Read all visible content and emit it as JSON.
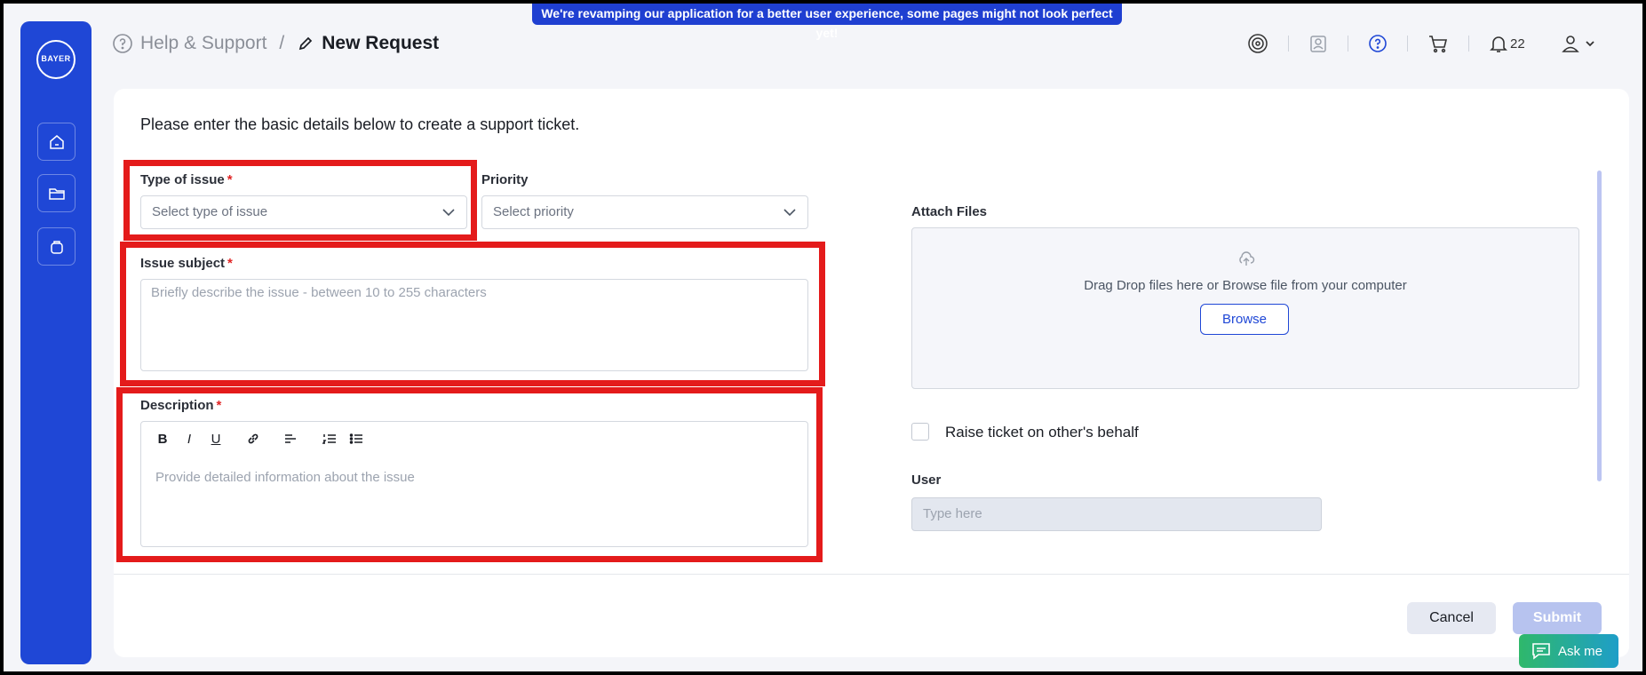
{
  "banner": {
    "text": "We're revamping our application for a better user experience, some pages might not look perfect yet!"
  },
  "sidebar": {
    "logo_text": "BAYER",
    "logo_vertical": "BAYER",
    "items": [
      {
        "icon": "home-icon"
      },
      {
        "icon": "folder-icon"
      },
      {
        "icon": "bag-icon"
      }
    ]
  },
  "breadcrumb": {
    "parent": "Help & Support",
    "separator": "/",
    "current": "New Request"
  },
  "header_icons": {
    "notification_count": "22"
  },
  "form": {
    "intro": "Please enter the basic details below to create a support ticket.",
    "type_of_issue": {
      "label": "Type of issue",
      "required_mark": "*",
      "placeholder": "Select type of issue"
    },
    "priority": {
      "label": "Priority",
      "placeholder": "Select priority"
    },
    "issue_subject": {
      "label": "Issue subject",
      "required_mark": "*",
      "placeholder": "Briefly describe the issue - between 10 to 255 characters"
    },
    "description": {
      "label": "Description",
      "required_mark": "*",
      "placeholder": "Provide detailed information about the issue",
      "toolbar": {
        "bold": "B",
        "italic": "I",
        "underline": "U"
      }
    },
    "attach": {
      "label": "Attach Files",
      "drop_text": "Drag Drop files here or Browse file from your computer",
      "browse_label": "Browse"
    },
    "behalf": {
      "label": "Raise ticket on other's behalf",
      "checked": false
    },
    "user": {
      "label": "User",
      "placeholder": "Type here"
    }
  },
  "footer": {
    "cancel_label": "Cancel",
    "submit_label": "Submit"
  },
  "askme": {
    "label": "Ask me"
  },
  "colors": {
    "brand": "#1f47d6",
    "highlight": "#e41b1b",
    "required": "#e02424",
    "askme_start": "#2fb86b",
    "askme_end": "#1e9ec8"
  }
}
